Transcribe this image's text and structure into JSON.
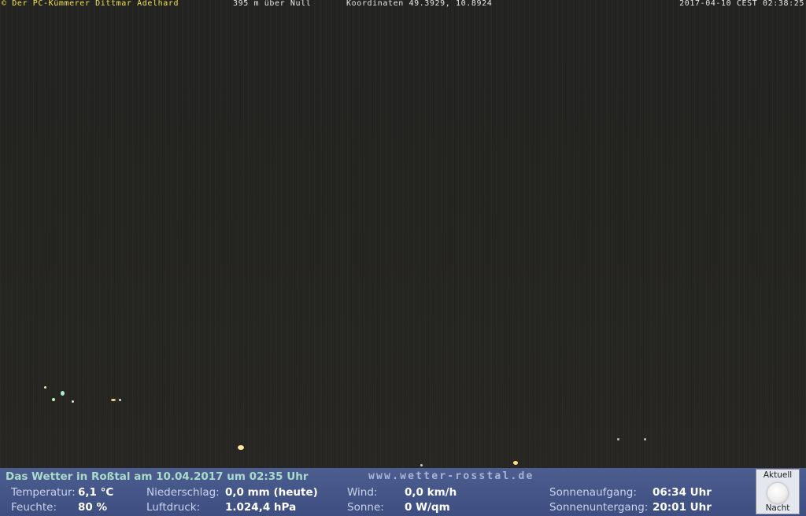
{
  "overlay": {
    "credit": "© Der PC-Kümmerer Dittmar Adelhard",
    "altitude": "395 m über Null",
    "coords": "Koordinaten 49.3929, 10.8924",
    "timestamp": "2017-04-10 CEST 02:38:25"
  },
  "panel": {
    "headline": "Das Wetter in Roßtal am 10.04.2017 um 02:35 Uhr",
    "site": "www.wetter-rosstal.de",
    "temperature_label": "Temperatur:",
    "temperature_value": "6,1 °C",
    "humidity_label": "Feuchte:",
    "humidity_value": "80 %",
    "precip_label": "Niederschlag:",
    "precip_value": "0,0 mm (heute)",
    "pressure_label": "Luftdruck:",
    "pressure_value": "1.024,4 hPa",
    "wind_label": "Wind:",
    "wind_value": "0,0 km/h",
    "sun_label": "Sonne:",
    "sun_value": "0 W/qm",
    "sunrise_label": "Sonnenaufgang:",
    "sunrise_value": "06:34 Uhr",
    "sunset_label": "Sonnenuntergang:",
    "sunset_value": "20:01 Uhr"
  },
  "moon": {
    "top_label": "Aktuell",
    "bottom_label": "Nacht",
    "icon": "moon-icon"
  },
  "colors": {
    "credit": "#f2e24c",
    "panel_bg": "#46578a",
    "headline": "#a9dcc8"
  }
}
